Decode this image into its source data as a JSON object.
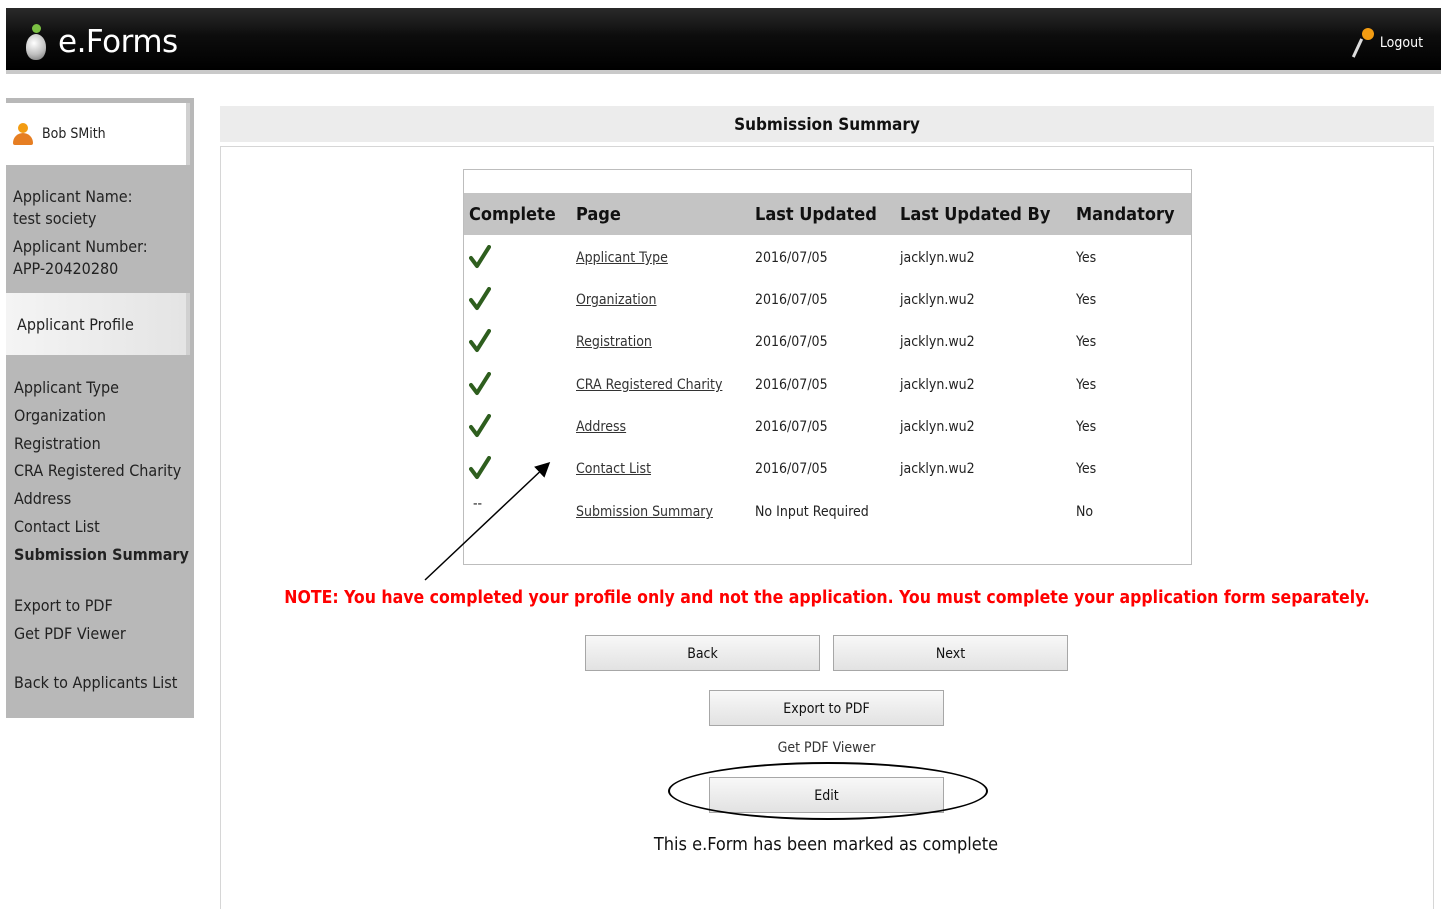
{
  "header": {
    "app_name": "e.Forms",
    "logout_label": "Logout"
  },
  "sidebar": {
    "user_name": "Bob SMith",
    "applicant_name_label": "Applicant Name:",
    "applicant_name_value": "test society",
    "applicant_number_label": "Applicant Number:",
    "applicant_number_value": "APP-20420280",
    "profile_heading": "Applicant Profile",
    "nav_items": [
      {
        "label": "Applicant Type"
      },
      {
        "label": "Organization"
      },
      {
        "label": "Registration"
      },
      {
        "label": "CRA Registered Charity"
      },
      {
        "label": "Address"
      },
      {
        "label": "Contact List"
      },
      {
        "label": "Submission Summary"
      }
    ],
    "export_pdf": "Export to PDF",
    "get_pdf_viewer": "Get PDF Viewer",
    "back_to_list": "Back to Applicants List"
  },
  "main": {
    "title": "Submission Summary",
    "columns": [
      "Complete",
      "Page",
      "Last Updated",
      "Last Updated By",
      "Mandatory"
    ],
    "rows": [
      {
        "complete": true,
        "page": "Applicant Type",
        "last_updated": "2016/07/05",
        "updated_by": "jacklyn.wu2",
        "mandatory": "Yes"
      },
      {
        "complete": true,
        "page": "Organization",
        "last_updated": "2016/07/05",
        "updated_by": "jacklyn.wu2",
        "mandatory": "Yes"
      },
      {
        "complete": true,
        "page": "Registration",
        "last_updated": "2016/07/05",
        "updated_by": "jacklyn.wu2",
        "mandatory": "Yes"
      },
      {
        "complete": true,
        "page": "CRA Registered Charity",
        "last_updated": "2016/07/05",
        "updated_by": "jacklyn.wu2",
        "mandatory": "Yes"
      },
      {
        "complete": true,
        "page": "Address",
        "last_updated": "2016/07/05",
        "updated_by": "jacklyn.wu2",
        "mandatory": "Yes"
      },
      {
        "complete": true,
        "page": "Contact List",
        "last_updated": "2016/07/05",
        "updated_by": "jacklyn.wu2",
        "mandatory": "Yes"
      },
      {
        "complete": false,
        "complete_text": "--",
        "page": "Submission Summary",
        "last_updated": "No Input Required",
        "updated_by": "",
        "mandatory": "No"
      }
    ],
    "note": "NOTE: You have completed your profile only and not the application. You must complete your application form separately.",
    "back_label": "Back",
    "next_label": "Next",
    "export_label": "Export to PDF",
    "pdf_viewer_label": "Get PDF Viewer",
    "edit_label": "Edit",
    "complete_message": "This e.Form has been marked as complete"
  },
  "colors": {
    "note": "#ff0000",
    "check": "#2e5e1e",
    "sidebar_bg": "#b8b8b8",
    "header_bg": "#000000"
  }
}
